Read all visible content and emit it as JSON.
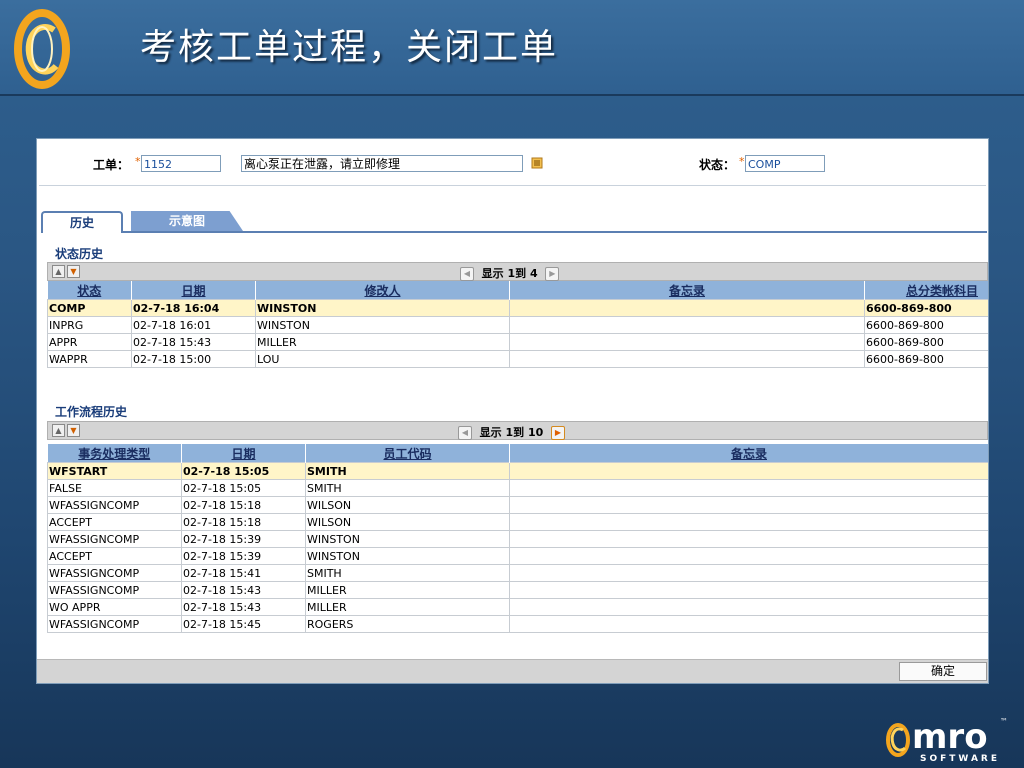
{
  "header": {
    "title": "考核工单过程，关闭工单"
  },
  "form": {
    "workorder_label": "工单：",
    "workorder_value": "1152",
    "description_value": "离心泵正在泄露，请立即修理",
    "status_label": "状态：",
    "status_value": "COMP",
    "required_mark": "*"
  },
  "tabs": [
    {
      "label": "历史"
    },
    {
      "label": "示意图"
    }
  ],
  "status_history": {
    "title": "状态历史",
    "pager": "显示 1到 4",
    "columns": [
      "状态",
      "日期",
      "修改人",
      "备忘录",
      "总分类帐科目"
    ],
    "rows": [
      [
        "COMP",
        "02-7-18 16:04",
        "WINSTON",
        "",
        "6600-869-800"
      ],
      [
        "INPRG",
        "02-7-18 16:01",
        "WINSTON",
        "",
        "6600-869-800"
      ],
      [
        "APPR",
        "02-7-18 15:43",
        "MILLER",
        "",
        "6600-869-800"
      ],
      [
        "WAPPR",
        "02-7-18 15:00",
        "LOU",
        "",
        "6600-869-800"
      ]
    ]
  },
  "workflow_history": {
    "title": "工作流程历史",
    "pager": "显示 1到 10",
    "columns": [
      "事务处理类型",
      "日期",
      "员工代码",
      "备忘录"
    ],
    "rows": [
      [
        "WFSTART",
        "02-7-18 15:05",
        "SMITH",
        ""
      ],
      [
        "FALSE",
        "02-7-18 15:05",
        "SMITH",
        ""
      ],
      [
        "WFASSIGNCOMP",
        "02-7-18 15:18",
        "WILSON",
        ""
      ],
      [
        "ACCEPT",
        "02-7-18 15:18",
        "WILSON",
        ""
      ],
      [
        "WFASSIGNCOMP",
        "02-7-18 15:39",
        "WINSTON",
        ""
      ],
      [
        "ACCEPT",
        "02-7-18 15:39",
        "WINSTON",
        ""
      ],
      [
        "WFASSIGNCOMP",
        "02-7-18 15:41",
        "SMITH",
        ""
      ],
      [
        "WFASSIGNCOMP",
        "02-7-18 15:43",
        "MILLER",
        ""
      ],
      [
        "WO APPR",
        "02-7-18 15:43",
        "MILLER",
        ""
      ],
      [
        "WFASSIGNCOMP",
        "02-7-18 15:45",
        "ROGERS",
        ""
      ]
    ]
  },
  "footer": {
    "ok_label": "确定"
  },
  "brand": {
    "name": "mro",
    "tagline": "SOFTWARE",
    "tm": "™"
  },
  "colors": {
    "accent": "#e06000",
    "header_blue": "#8fb2da",
    "selected_row": "#fff5c8"
  }
}
